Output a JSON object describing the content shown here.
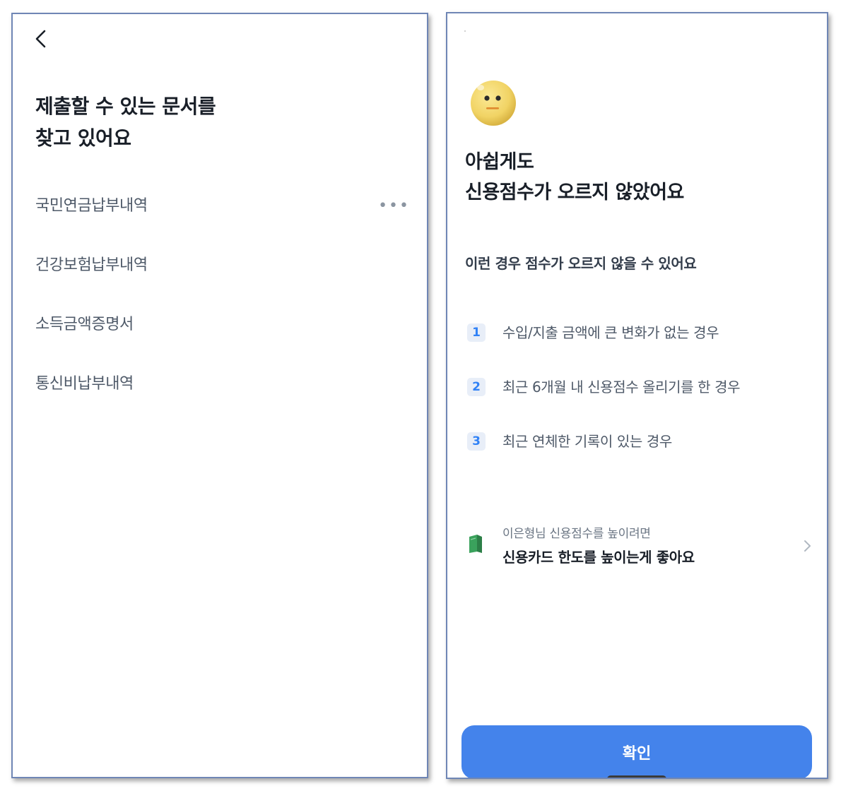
{
  "left_screen": {
    "title_lines": [
      "제출할 수 있는 문서를",
      "찾고 있어요"
    ],
    "documents": [
      {
        "label": "국민연금납부내역",
        "status": "•••"
      },
      {
        "label": "건강보험납부내역"
      },
      {
        "label": "소득금액증명서"
      },
      {
        "label": "통신비납부내역"
      }
    ]
  },
  "right_screen": {
    "title_lines": [
      "아쉽게도",
      "신용점수가 오르지 않았어요"
    ],
    "subheading": "이런 경우 점수가 오르지 않을 수 있어요",
    "reasons": [
      {
        "num": "1",
        "text": "수입/지출 금액에 큰 변화가 없는 경우"
      },
      {
        "num": "2",
        "text": "최근 6개월 내 신용점수 올리기를 한 경우"
      },
      {
        "num": "3",
        "text": "최근 연체한 기록이 있는 경우"
      }
    ],
    "tip": {
      "caption": "이은형님 신용점수를 높이려면",
      "main": "신용카드 한도를 높이는게 좋아요"
    },
    "confirm_label": "확인"
  },
  "colors": {
    "accent": "#4483eb",
    "title": "#191f28",
    "body_text": "#4e5968",
    "badge_bg": "#e8eef8",
    "badge_text": "#3182f6"
  },
  "icons": {
    "back": "chevron-left-icon",
    "face": "neutral-face-icon",
    "tip": "green-book-icon",
    "tip_chevron": "chevron-right-icon"
  }
}
